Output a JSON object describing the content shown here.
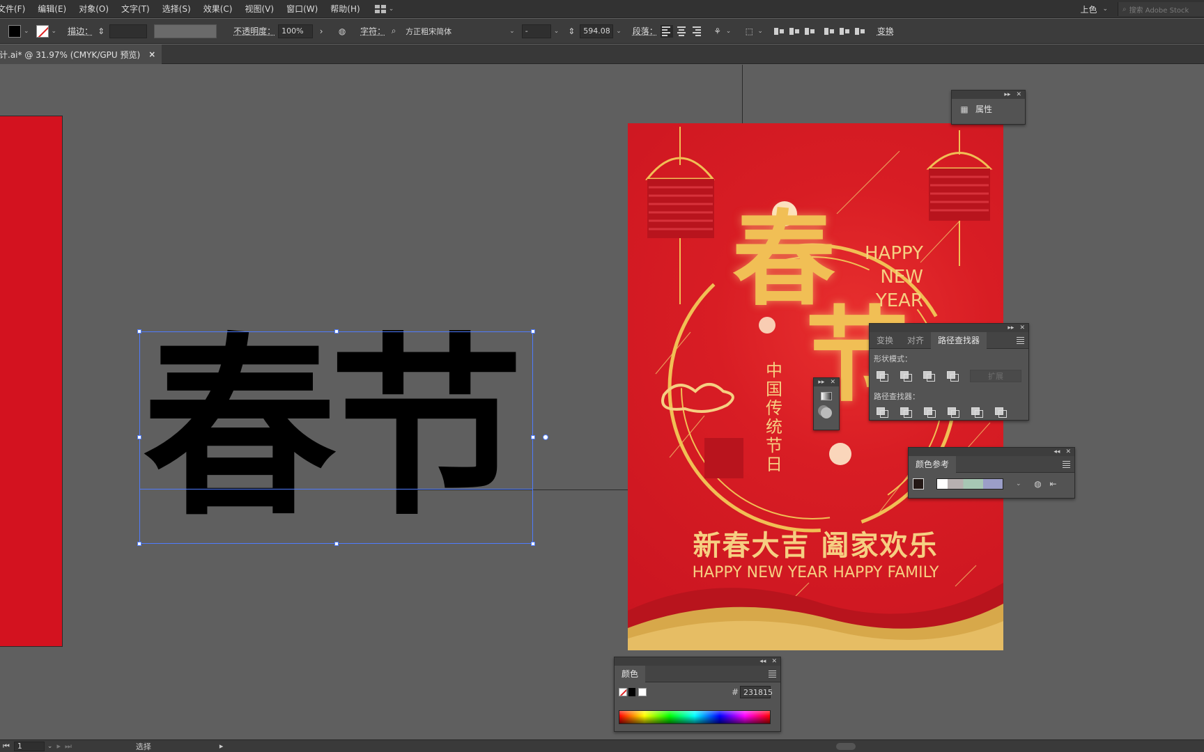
{
  "menubar": {
    "items": [
      "文件(F)",
      "编辑(E)",
      "对象(O)",
      "文字(T)",
      "选择(S)",
      "效果(C)",
      "视图(V)",
      "窗口(W)",
      "帮助(H)"
    ],
    "workspace": "上色",
    "search_placeholder": "搜索 Adobe Stock"
  },
  "controlbar": {
    "stroke_label": "描边：",
    "opacity_label": "不透明度：",
    "opacity_value": "100%",
    "char_label": "字符：",
    "font_name": "方正粗宋简体",
    "font_style": "-",
    "font_size": "594.08",
    "paragraph_label": "段落：",
    "transform_label": "变换"
  },
  "document": {
    "tab_title": "计.ai* @ 31.97% (CMYK/GPU 预览)",
    "close": "×"
  },
  "artwork": {
    "big_text": "春节"
  },
  "poster": {
    "happy_lines": [
      "HAPPY",
      "NEW",
      "YEAR"
    ],
    "cal_char_1": "春",
    "cal_char_2": "节",
    "vertical_text": "中国传统节日",
    "blessing_cn": "新春大吉 阖家欢乐",
    "blessing_en": "HAPPY NEW YEAR HAPPY FAMILY"
  },
  "panels": {
    "properties": {
      "label": "属性"
    },
    "pathfinder": {
      "tabs": [
        "变换",
        "对齐",
        "路径查找器"
      ],
      "active_tab": "路径查找器",
      "shape_modes_label": "形状模式：",
      "expand_label": "扩展",
      "pathfinders_label": "路径查找器："
    },
    "color_guide": {
      "title": "颜色参考"
    },
    "color": {
      "title": "颜色",
      "hex_label": "#",
      "hex_value": "231815"
    }
  },
  "statusbar": {
    "artboard_number": "1",
    "tool_label": "选择"
  },
  "colors": {
    "poster_red": "#d81d24",
    "gold": "#f1bf55",
    "selection_blue": "#4f7cff",
    "artboard_left_red": "#d3121f"
  }
}
